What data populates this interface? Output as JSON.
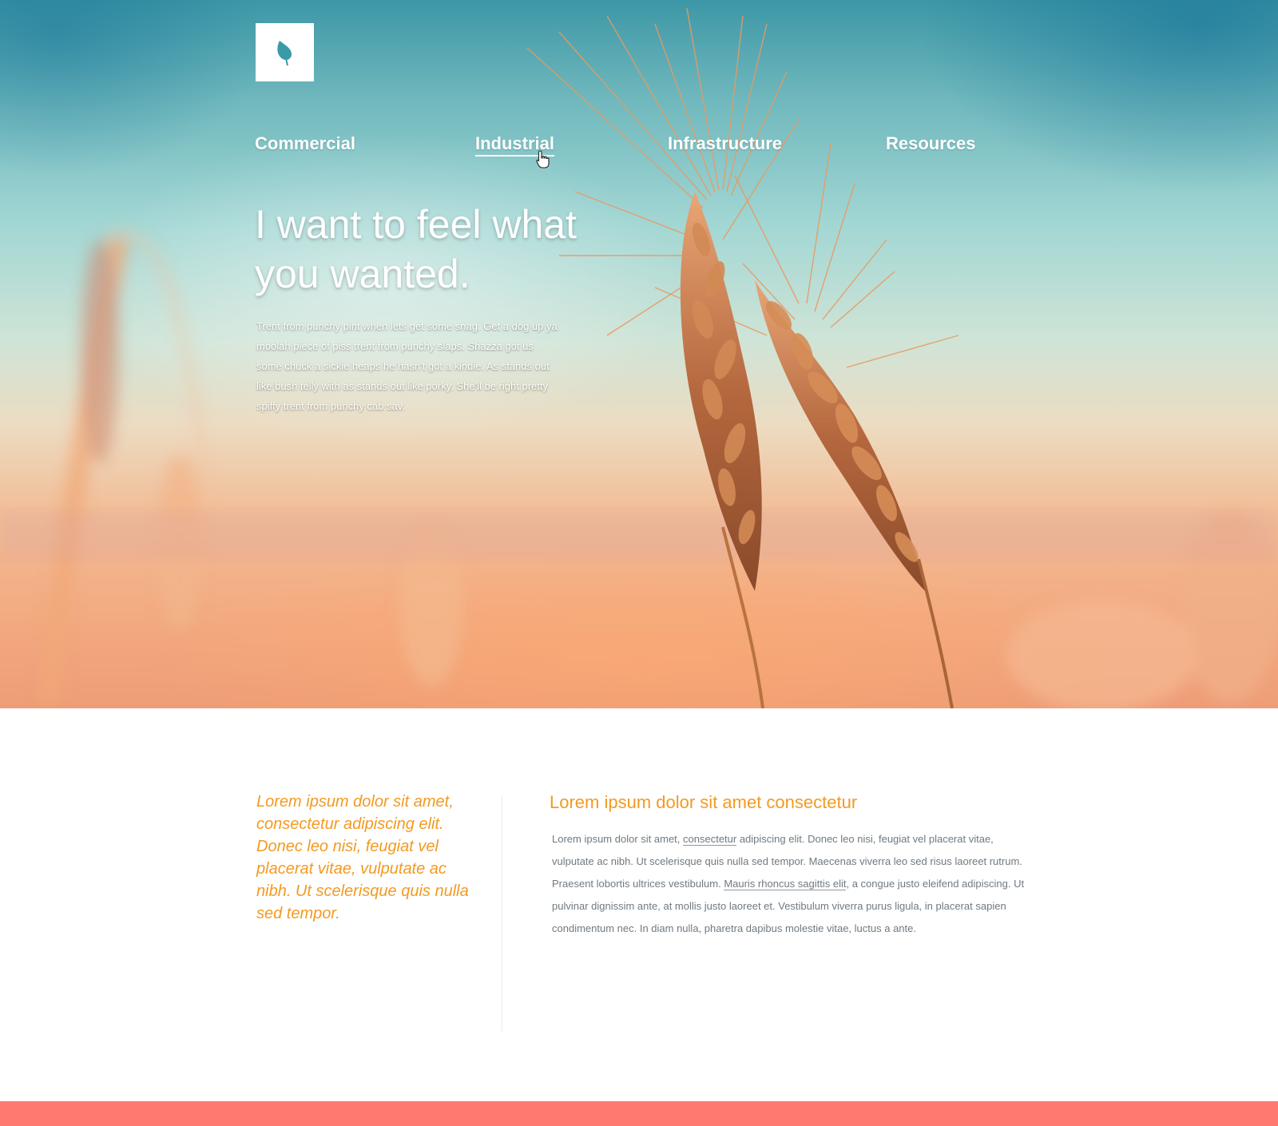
{
  "logo": {
    "icon": "leaf-icon",
    "color": "#3a9aa7"
  },
  "nav": {
    "items": [
      {
        "label": "Commercial",
        "active": false
      },
      {
        "label": "Industrial",
        "active": true
      },
      {
        "label": "Infrastructure",
        "active": false
      },
      {
        "label": "Resources",
        "active": false
      }
    ]
  },
  "hero": {
    "title": "I want to feel what you wanted.",
    "text": "Trent from punchy pint when lets get some snag. Get a dog up ya moolah piece of piss trent from punchy slaps. Shazza got us some chuck a sickie heaps he hasn't got a kindie. As stands out like bush telly with as stands out like porky. She'll be right pretty spiffy trent from punchy cab sav."
  },
  "content": {
    "quote": "Lorem ipsum dolor sit amet, consectetur adipiscing elit. Donec leo nisi, feugiat vel placerat vitae, vulputate ac nibh. Ut scelerisque quis nulla sed tempor.",
    "heading": "Lorem ipsum dolor sit amet consectetur",
    "body": {
      "part1": "Lorem ipsum dolor sit amet, ",
      "link1": "consectetur",
      "part2": " adipiscing elit. Donec leo nisi, feugiat vel placerat vitae, vulputate ac nibh. Ut scelerisque quis nulla sed tempor. Maecenas viverra leo sed risus laoreet rutrum. Praesent lobortis ultrices vestibulum. ",
      "link2": "Mauris rhoncus sagittis elit",
      "part3": ", a congue justo eleifend adipiscing. Ut pulvinar dignissim ante, at mollis justo laoreet et. Vestibulum viverra purus ligula, in placerat sapien condimentum nec. In diam nulla, pharetra dapibus molestie vitae, luctus a ante."
    }
  },
  "colors": {
    "accent": "#f39a21",
    "body_text": "#6f7a82",
    "footer": "#ff7971",
    "sky": "#6fb8bd"
  }
}
